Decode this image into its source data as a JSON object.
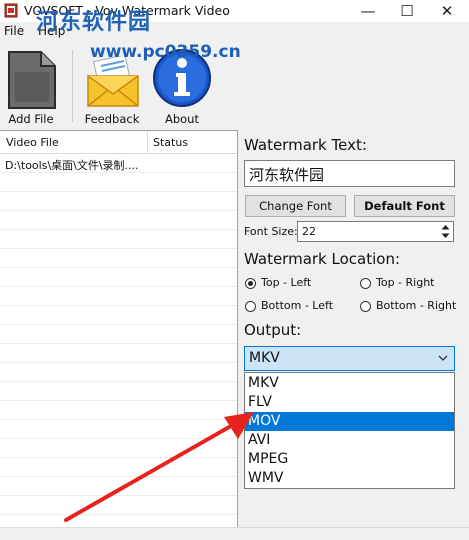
{
  "window": {
    "title": "VOVSOFT - Vov Watermark Video",
    "minimize": "—",
    "maximize": "☐",
    "close": "✕"
  },
  "overlay": {
    "site_name": "河东软件园",
    "site_url": "www.pc0359.cn",
    "arrow_color": "#e8231e"
  },
  "menu": {
    "file": "File",
    "help": "Help"
  },
  "toolbar": {
    "add_file": "Add File",
    "feedback": "Feedback",
    "about": "About"
  },
  "list": {
    "columns": [
      "Video File",
      "Status"
    ],
    "rows": [
      {
        "file": "D:\\tools\\桌面\\文件\\录制....",
        "status": ""
      }
    ]
  },
  "panel": {
    "watermark_text_label": "Watermark Text:",
    "watermark_text_value": "河东软件园",
    "change_font": "Change Font",
    "default_font": "Default Font",
    "font_size_label": "Font Size:",
    "font_size_value": "22",
    "location_label": "Watermark Location:",
    "locations": {
      "top_left": "Top - Left",
      "top_right": "Top - Right",
      "bottom_left": "Bottom - Left",
      "bottom_right": "Bottom - Right"
    },
    "selected_location": "top_left",
    "output_label": "Output:",
    "output_selected": "MKV",
    "output_options": [
      "MKV",
      "FLV",
      "MOV",
      "AVI",
      "MPEG",
      "WMV"
    ],
    "highlighted_option": "MOV"
  },
  "colors": {
    "accent": "#0078d7",
    "select_bg": "#cce4f7"
  }
}
